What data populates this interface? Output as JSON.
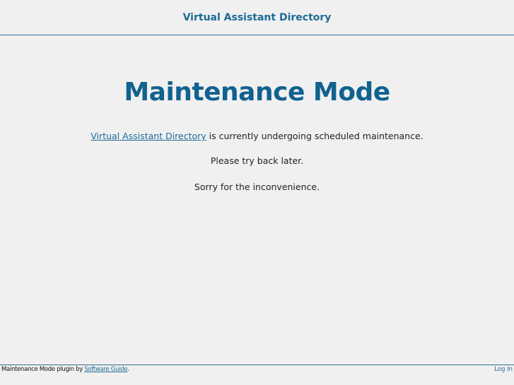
{
  "header": {
    "site_title": "Virtual Assistant Directory"
  },
  "main": {
    "title": "Maintenance Mode",
    "message_link": "Virtual Assistant Directory",
    "message_rest": " is currently undergoing scheduled maintenance.",
    "line2": "Please try back later.",
    "line3": "Sorry for the inconvenience."
  },
  "footer": {
    "credit_prefix": "Maintenance Mode plugin by ",
    "credit_link": "Software Guide",
    "credit_suffix": ".",
    "login_label": "Log In"
  },
  "colors": {
    "background": "#f0f0f0",
    "accent": "#1d6b96",
    "title": "#10628f"
  }
}
